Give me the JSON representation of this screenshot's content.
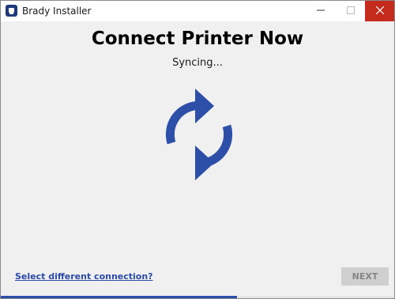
{
  "window": {
    "title": "Brady Installer",
    "app_icon": "brady-app-icon",
    "controls": [
      "minimize-icon",
      "maximize-icon",
      "close-icon"
    ]
  },
  "main": {
    "heading": "Connect Printer Now",
    "status": "Syncing...",
    "sync_icon": "sync-arrows-icon",
    "link_label": "Select different connection?",
    "next_label": "NEXT",
    "next_enabled": false,
    "progress": 0.6
  },
  "colors": {
    "accent": "#2d4fa8",
    "close_button": "#c42b1c",
    "link": "#2b4aa8",
    "disabled_button_bg": "#cfcfcf",
    "disabled_button_text": "#858585",
    "window_bg": "#f0f0f0"
  }
}
